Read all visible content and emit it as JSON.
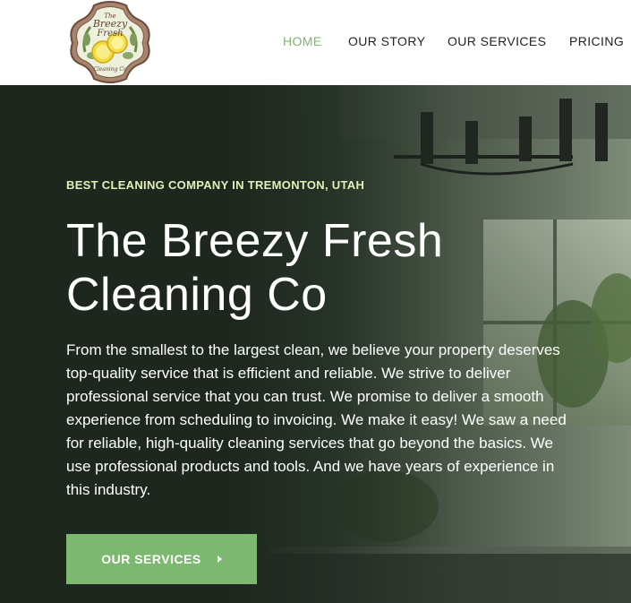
{
  "brand": {
    "logo_name": "Breezy Fresh",
    "logo_text_top": "The",
    "logo_text_main": "Breezy",
    "logo_text_main2": "Fresh",
    "logo_text_bottom": "Cleaning Co",
    "accent_color": "#7cb870"
  },
  "nav": {
    "items": [
      {
        "label": "HOME",
        "active": true
      },
      {
        "label": "OUR STORY",
        "active": false
      },
      {
        "label": "OUR SERVICES",
        "active": false
      },
      {
        "label": "PRICING",
        "active": false
      }
    ]
  },
  "hero": {
    "eyebrow": "BEST CLEANING COMPANY IN TREMONTON, UTAH",
    "title": "The Breezy Fresh Cleaning Co",
    "description": "From the smallest to the largest clean, we believe your property deserves top-quality service that is efficient and reliable. We strive to deliver professional service that you can trust. We promise to deliver a smooth experience from scheduling to invoicing. We make it easy! We saw a need for reliable, high-quality cleaning services that go beyond the basics. We use professional products and tools. And we have years of experience in this industry.",
    "cta_label": "OUR SERVICES",
    "cta_icon": "caret-right-icon",
    "background_color": "#1f2a20",
    "eyebrow_color": "#e3efb8"
  }
}
